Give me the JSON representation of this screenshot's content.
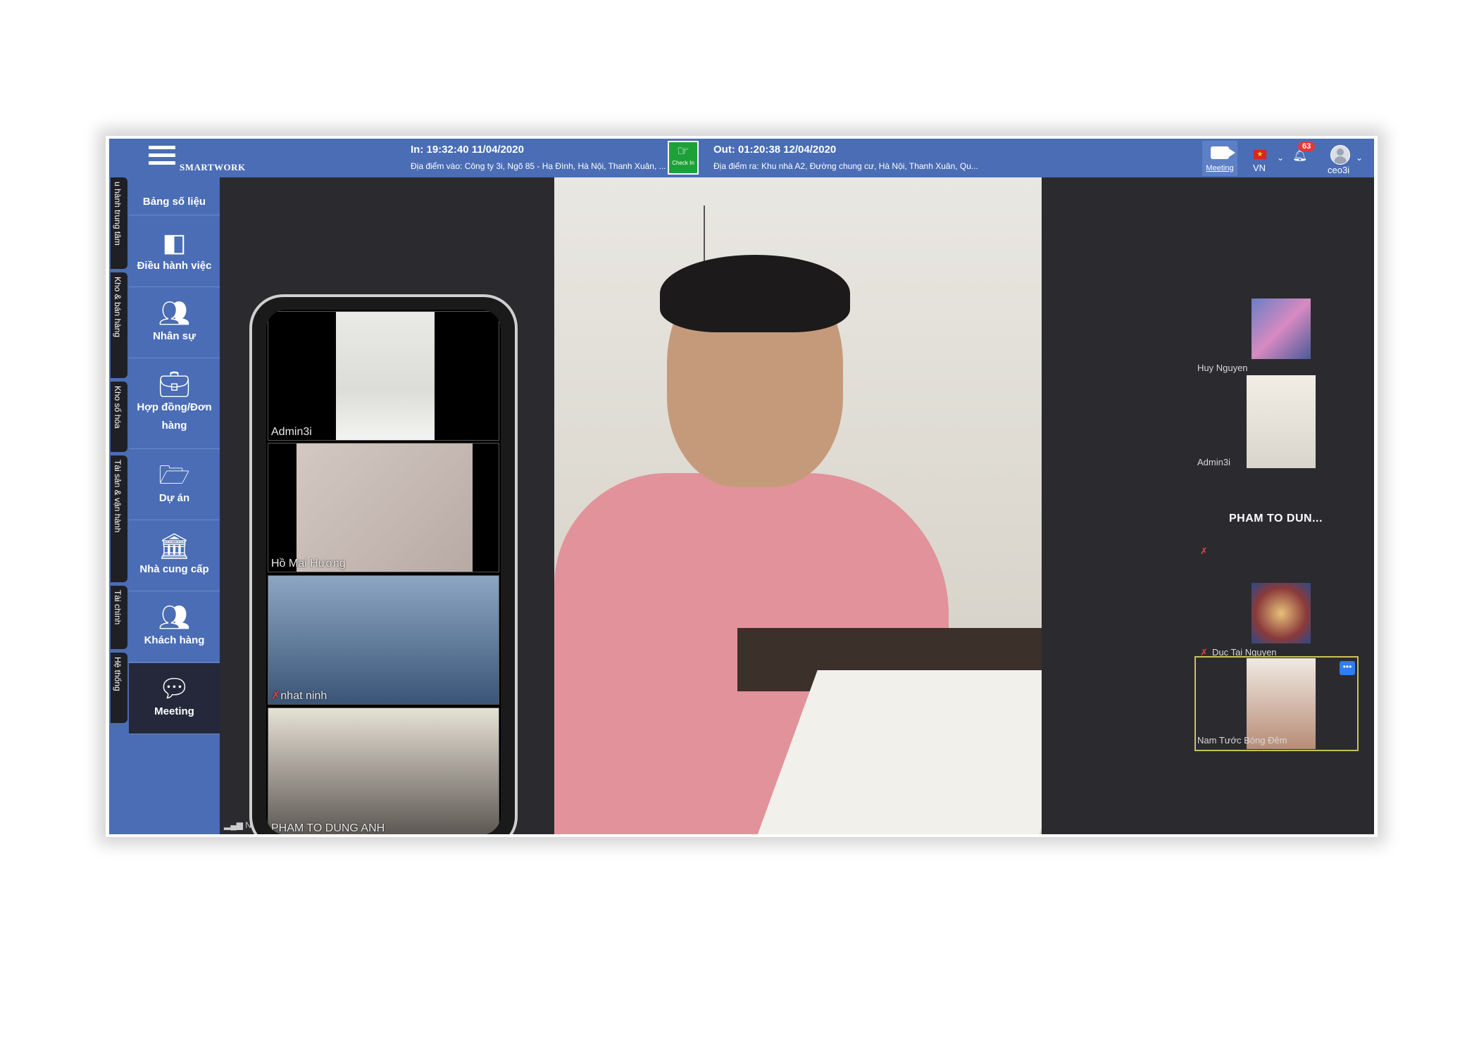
{
  "app": {
    "brand": "SMARTWORK"
  },
  "topbar": {
    "checkin_time": "In: 19:32:40 11/04/2020",
    "checkin_location": "Địa điểm vào: Công ty 3i, Ngõ 85 - Hạ Đình, Hà Nội, Thanh Xuân, ...",
    "checkin_button": "Check In",
    "checkout_time": "Out: 01:20:38 12/04/2020",
    "checkout_location": "Địa điểm ra: Khu nhà A2, Đường chung cư, Hà Nội, Thanh Xuân, Qu...",
    "meeting_label": "Meeting",
    "language": "VN",
    "notifications": "63",
    "username": "ceo3i"
  },
  "rail_tabs": [
    {
      "label": "u hành trung tâm"
    },
    {
      "label": "Kho & bán hàng"
    },
    {
      "label": "Kho số hóa"
    },
    {
      "label": "Tài sản & vận hành"
    },
    {
      "label": "Tài chính"
    },
    {
      "label": "Hệ thống"
    }
  ],
  "menu": [
    {
      "label": "Bảng số liệu",
      "icon": "chart-icon"
    },
    {
      "label": "Điều hành việc",
      "icon": "board-icon"
    },
    {
      "label": "Nhân sự",
      "icon": "people-icon"
    },
    {
      "label": "Hợp đồng/Đơn",
      "label2": "hàng",
      "icon": "briefcase-icon"
    },
    {
      "label": "Dự án",
      "icon": "folder-icon"
    },
    {
      "label": "Nhà cung cấp",
      "icon": "bank-icon"
    },
    {
      "label": "Khách hàng",
      "icon": "people-icon"
    },
    {
      "label": "Meeting",
      "icon": "chat-icon",
      "active": true
    }
  ],
  "phone_tiles": [
    {
      "name": "Admin3i"
    },
    {
      "name": "Hồ Mai Hương"
    },
    {
      "name": "nhat ninh"
    },
    {
      "name": "PHAM TO DUNG ANH"
    }
  ],
  "participants": [
    {
      "name": "Huy Nguyen"
    },
    {
      "name": "Admin3i"
    },
    {
      "name": "PHAM TO DUN..."
    },
    {
      "name": "Duc Tai Nguyen"
    },
    {
      "name": "Nam Tước Bóng Đêm"
    }
  ],
  "stage": {
    "bottom_label": "Nam"
  },
  "colors": {
    "topbar": "#4a6db5",
    "checkin": "#1ea038",
    "badge": "#e53935",
    "active_menu": "#24283a"
  }
}
